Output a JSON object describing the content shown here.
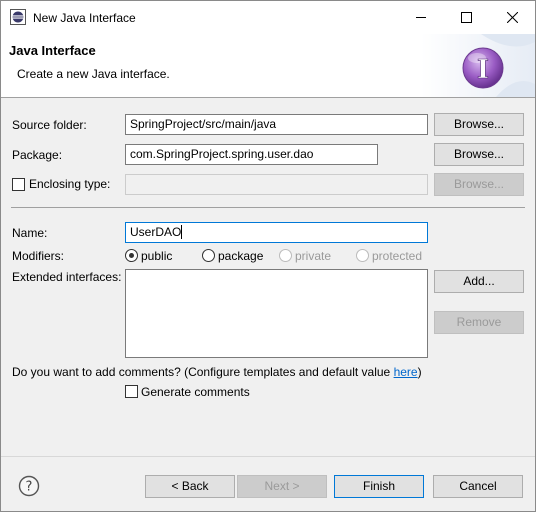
{
  "window": {
    "title": "New Java Interface",
    "icons": {
      "app": "eclipse-app-icon",
      "minimize": "minimize-icon",
      "maximize": "maximize-icon",
      "close": "close-icon"
    }
  },
  "banner": {
    "title": "Java Interface",
    "message": "Create a new Java interface.",
    "graphic": "interface-wizard-icon",
    "graphic_letter": "I"
  },
  "form": {
    "source_folder": {
      "label": "Source folder:",
      "value": "SpringProject/src/main/java",
      "button": "Browse..."
    },
    "package": {
      "label": "Package:",
      "value": "com.SpringProject.spring.user.dao",
      "button": "Browse..."
    },
    "enclosing_type": {
      "label": "Enclosing type:",
      "checked": false,
      "value": "",
      "button": "Browse..."
    },
    "name": {
      "label": "Name:",
      "value": "UserDAO"
    },
    "modifiers": {
      "label": "Modifiers:",
      "options": [
        {
          "label": "public",
          "selected": true,
          "enabled": true
        },
        {
          "label": "package",
          "selected": false,
          "enabled": true
        },
        {
          "label": "private",
          "selected": false,
          "enabled": false
        },
        {
          "label": "protected",
          "selected": false,
          "enabled": false
        }
      ]
    },
    "extended_interfaces": {
      "label": "Extended interfaces:",
      "items": [],
      "add_button": "Add...",
      "remove_button": "Remove"
    },
    "comments": {
      "question": "Do you want to add comments? (Configure templates and default value ",
      "link": "here",
      "question_end": ")",
      "generate_label": "Generate comments",
      "generate_checked": false
    }
  },
  "footer": {
    "help_icon": "help-icon",
    "help_glyph": "?",
    "back": "< Back",
    "next": "Next >",
    "finish": "Finish",
    "cancel": "Cancel"
  },
  "colors": {
    "accent": "#0078d7",
    "link": "#0066cc",
    "wizard_purple": "#7b3fa0"
  }
}
